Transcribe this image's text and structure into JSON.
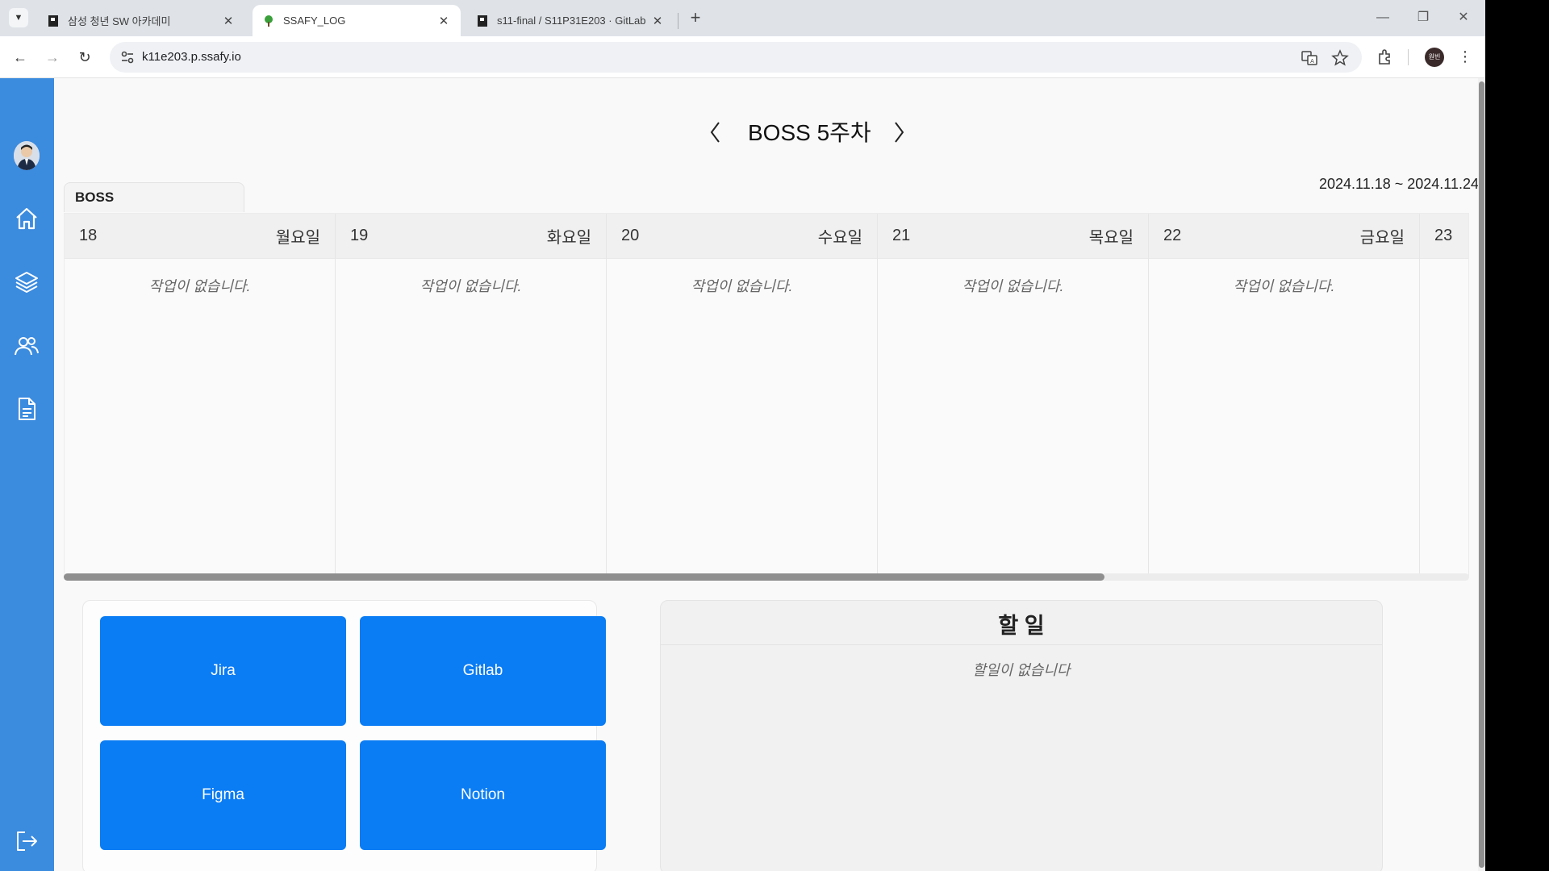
{
  "browser": {
    "tabs": [
      {
        "title": "삼성 청년 SW 아카데미",
        "favicon": "ssafy-favicon",
        "active": false
      },
      {
        "title": "SSAFY_LOG",
        "favicon": "leaf-favicon",
        "active": true
      },
      {
        "title": "s11-final / S11P31E203 · GitLab",
        "favicon": "ssafy-favicon",
        "active": false
      }
    ],
    "url": "k11e203.p.ssafy.io",
    "profile_label": "원빈"
  },
  "sidebar": {
    "items": [
      {
        "icon": "home-icon"
      },
      {
        "icon": "layers-icon"
      },
      {
        "icon": "users-icon"
      },
      {
        "icon": "document-icon"
      }
    ],
    "logout_icon": "logout-icon"
  },
  "header": {
    "title": "BOSS 5주차",
    "project_tab": "BOSS",
    "date_range": "2024.11.18 ~ 2024.11.24"
  },
  "calendar": {
    "days": [
      {
        "date": "18",
        "weekday": "월요일",
        "empty_text": "작업이 없습니다."
      },
      {
        "date": "19",
        "weekday": "화요일",
        "empty_text": "작업이 없습니다."
      },
      {
        "date": "20",
        "weekday": "수요일",
        "empty_text": "작업이 없습니다."
      },
      {
        "date": "21",
        "weekday": "목요일",
        "empty_text": "작업이 없습니다."
      },
      {
        "date": "22",
        "weekday": "금요일",
        "empty_text": "작업이 없습니다."
      },
      {
        "date": "23",
        "weekday": "",
        "empty_text": ""
      }
    ]
  },
  "links": {
    "jira": "Jira",
    "gitlab": "Gitlab",
    "figma": "Figma",
    "notion": "Notion"
  },
  "todo": {
    "title": "할 일",
    "empty_text": "할일이 없습니다"
  },
  "colors": {
    "sidebar": "#3b8bdf",
    "link_button": "#0a7cf4"
  }
}
